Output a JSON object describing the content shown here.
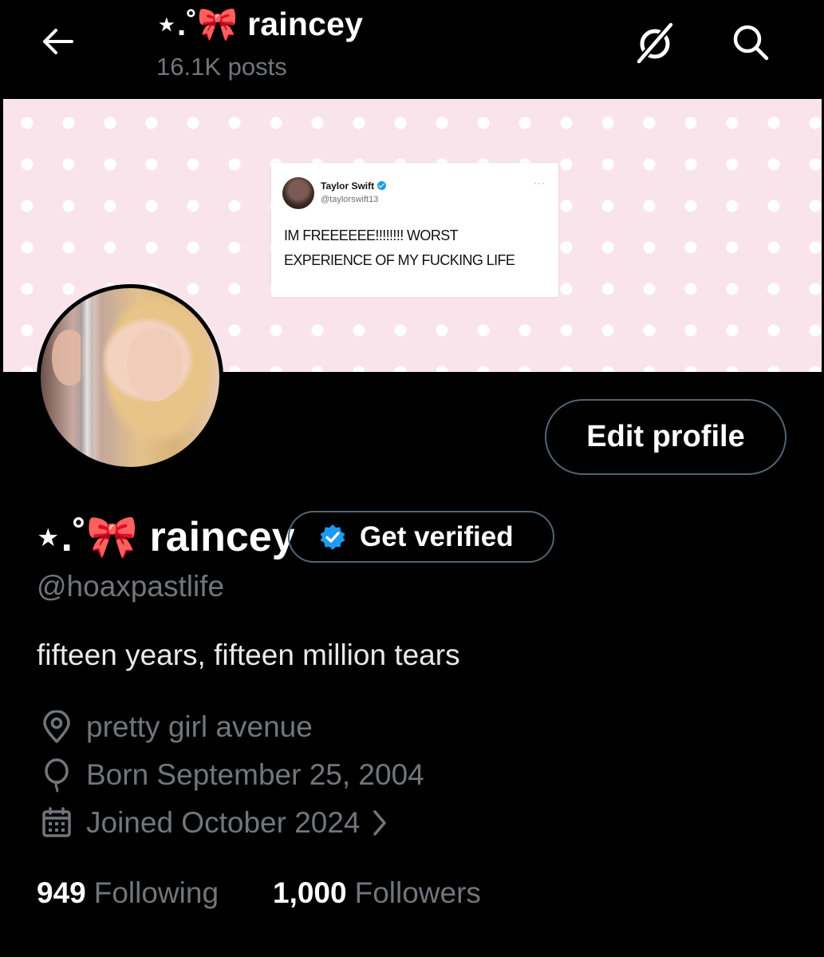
{
  "header": {
    "display_name": "⋆.˚🎀 raincey",
    "post_count": "16.1K posts"
  },
  "banner": {
    "tweet": {
      "author_name": "Taylor Swift",
      "author_handle": "@taylorswift13",
      "more": "···",
      "text": "IM FREEEEEE!!!!!!!! WORST EXPERIENCE OF MY FUCKING LIFE"
    }
  },
  "profile": {
    "edit_button_label": "Edit profile",
    "display_name": "⋆.˚🎀 raincey",
    "get_verified_label": "Get verified",
    "handle": "@hoaxpastlife",
    "bio": "fifteen years, fifteen million tears",
    "location": "pretty girl avenue",
    "birthday": "Born September 25, 2004",
    "joined": "Joined October 2024",
    "following_count": "949",
    "following_label": "Following",
    "followers_count": "1,000",
    "followers_label": "Followers"
  },
  "icons": {
    "back": "arrow-left-icon",
    "grok": "grok-icon",
    "search": "search-icon",
    "verified": "verified-badge-icon",
    "location": "location-pin-icon",
    "birthday": "balloon-icon",
    "joined": "calendar-icon",
    "chevron": "chevron-right-icon"
  },
  "colors": {
    "background": "#000000",
    "primary_text": "#e7e9ea",
    "secondary_text": "#71767b",
    "border": "#536471",
    "verified_blue": "#1d9bf0",
    "banner_pink": "#f9e4ec"
  }
}
